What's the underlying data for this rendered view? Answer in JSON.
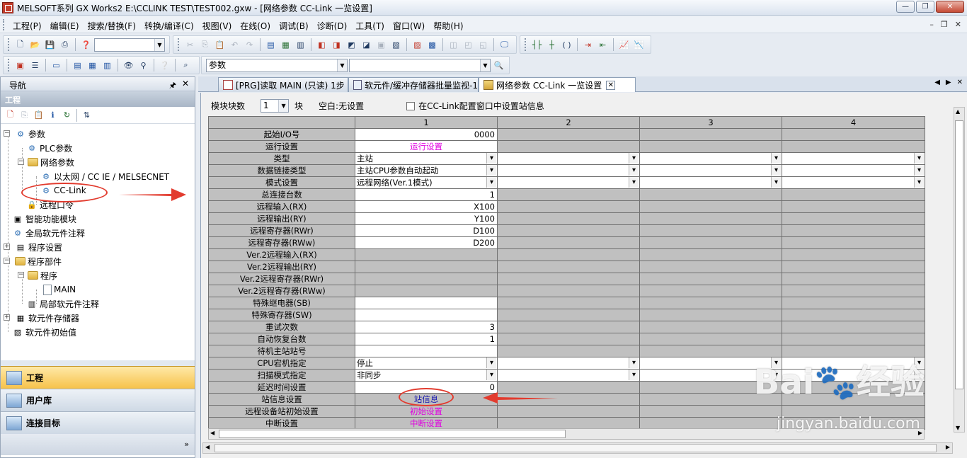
{
  "window": {
    "title": "MELSOFT系列 GX Works2 E:\\CCLINK TEST\\TEST002.gxw - [网络参数  CC-Link 一览设置]",
    "buttons": [
      "—",
      "❐",
      "✕"
    ]
  },
  "menu": {
    "items": [
      "工程(P)",
      "编辑(E)",
      "搜索/替换(F)",
      "转换/编译(C)",
      "视图(V)",
      "在线(O)",
      "调试(B)",
      "诊断(D)",
      "工具(T)",
      "窗口(W)",
      "帮助(H)"
    ],
    "mdi_buttons": [
      "–",
      "❐",
      "✕"
    ]
  },
  "toolbar2": {
    "combo_value": "参数"
  },
  "nav": {
    "title": "导航",
    "pin": "🖈",
    "close": "✕",
    "project_header": "工程",
    "tree": [
      {
        "label": "参数"
      },
      {
        "label": "PLC参数"
      },
      {
        "label": "网络参数"
      },
      {
        "label": "以太网 / CC IE / MELSECNET"
      },
      {
        "label": "CC-Link"
      },
      {
        "label": "远程口令"
      },
      {
        "label": "智能功能模块"
      },
      {
        "label": "全局软元件注释"
      },
      {
        "label": "程序设置"
      },
      {
        "label": "程序部件"
      },
      {
        "label": "程序"
      },
      {
        "label": "MAIN"
      },
      {
        "label": "局部软元件注释"
      },
      {
        "label": "软元件存储器"
      },
      {
        "label": "软元件初始值"
      }
    ],
    "bottom_tabs": [
      "工程",
      "用户库",
      "连接目标"
    ],
    "more": "»"
  },
  "tabs": [
    {
      "label": "[PRG]读取 MAIN (只读) 1步"
    },
    {
      "label": "软元件/缓冲存储器批量监视-1"
    },
    {
      "label": "网络参数  CC-Link 一览设置"
    }
  ],
  "settings": {
    "module_count_label": "模块块数",
    "module_count_value": "1",
    "unit": "块",
    "blank_info": "空白:无设置",
    "checkbox_label": "在CC-Link配置窗口中设置站信息"
  },
  "grid": {
    "columns": [
      "",
      "1",
      "2",
      "3",
      "4"
    ],
    "rows": [
      {
        "label": "起始I/O号",
        "value": "0000"
      },
      {
        "label": "运行设置",
        "value": "运行设置"
      },
      {
        "label": "类型",
        "value": "主站"
      },
      {
        "label": "数据链接类型",
        "value": "主站CPU参数自动起动"
      },
      {
        "label": "模式设置",
        "value": "远程网络(Ver.1模式)"
      },
      {
        "label": "总连接台数",
        "value": "1"
      },
      {
        "label": "远程输入(RX)",
        "value": "X100"
      },
      {
        "label": "远程输出(RY)",
        "value": "Y100"
      },
      {
        "label": "远程寄存器(RWr)",
        "value": "D100"
      },
      {
        "label": "远程寄存器(RWw)",
        "value": "D200"
      },
      {
        "label": "Ver.2远程输入(RX)",
        "value": ""
      },
      {
        "label": "Ver.2远程输出(RY)",
        "value": ""
      },
      {
        "label": "Ver.2远程寄存器(RWr)",
        "value": ""
      },
      {
        "label": "Ver.2远程寄存器(RWw)",
        "value": ""
      },
      {
        "label": "特殊继电器(SB)",
        "value": ""
      },
      {
        "label": "特殊寄存器(SW)",
        "value": ""
      },
      {
        "label": "重试次数",
        "value": "3"
      },
      {
        "label": "自动恢复台数",
        "value": "1"
      },
      {
        "label": "待机主站站号",
        "value": ""
      },
      {
        "label": "CPU宕机指定",
        "value": "停止"
      },
      {
        "label": "扫描模式指定",
        "value": "非同步"
      },
      {
        "label": "延迟时间设置",
        "value": "0"
      },
      {
        "label": "站信息设置",
        "value": "站信息"
      },
      {
        "label": "远程设备站初始设置",
        "value": "初始设置"
      },
      {
        "label": "中断设置",
        "value": "中断设置"
      }
    ]
  },
  "watermark": {
    "brand": "Bai🐾经验",
    "url": "jingyan.baidu.com"
  },
  "colors": {
    "accent": "#f6c24a",
    "annotation_red": "#e23b2e",
    "link_magenta": "#e000e0",
    "grid_gray": "#c0c0c0"
  }
}
